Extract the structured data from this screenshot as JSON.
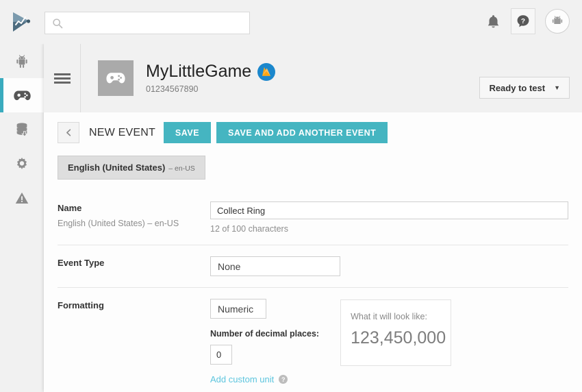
{
  "topbar": {
    "logo_icon": "play-console-logo",
    "search": {
      "value": "",
      "placeholder": ""
    },
    "search_icon": "search-icon",
    "notifications_icon": "bell-icon",
    "help_icon": "help-question-icon",
    "avatar_icon": "android-avatar-icon"
  },
  "rail": {
    "items": [
      {
        "icon": "android-robot-icon",
        "name": "all-applications",
        "active": false
      },
      {
        "icon": "gamepad-icon",
        "name": "game-services",
        "active": true
      },
      {
        "icon": "database-download-icon",
        "name": "reports",
        "active": false
      },
      {
        "icon": "gear-icon",
        "name": "settings",
        "active": false
      },
      {
        "icon": "warning-triangle-icon",
        "name": "alerts",
        "active": false
      }
    ]
  },
  "app_header": {
    "menu_icon": "hamburger-icon",
    "app_icon": "gamepad-icon",
    "title": "MyLittleGame",
    "badge_icon": "firebase-icon",
    "id": "01234567890",
    "status_label": "Ready to test",
    "status_caret": "▼"
  },
  "actions": {
    "back_icon": "chevron-left-icon",
    "page_title": "NEW EVENT",
    "save_label": "SAVE",
    "save_add_label": "SAVE AND ADD ANOTHER EVENT"
  },
  "language_tab": {
    "primary": "English (United States)",
    "secondary": "– en-US"
  },
  "form": {
    "name": {
      "label": "Name",
      "sublabel": "English (United States) – en-US",
      "value": "Collect Ring",
      "placeholder": "",
      "char_count": "12 of 100 characters"
    },
    "event_type": {
      "label": "Event Type",
      "value": "None"
    },
    "formatting": {
      "label": "Formatting",
      "format_value": "Numeric",
      "decimal_label": "Number of decimal places:",
      "decimal_value": "0",
      "custom_unit_link": "Add custom unit",
      "help_icon": "help-question-icon",
      "preview_label": "What it will look like:",
      "preview_value": "123,450,000"
    }
  },
  "colors": {
    "teal_accent": "#45b5c1",
    "rail_active": "#3aabbe",
    "link_blue": "#5cc5de",
    "firebase_blue": "#1b87cc",
    "firebase_flame": "#ffa712"
  }
}
